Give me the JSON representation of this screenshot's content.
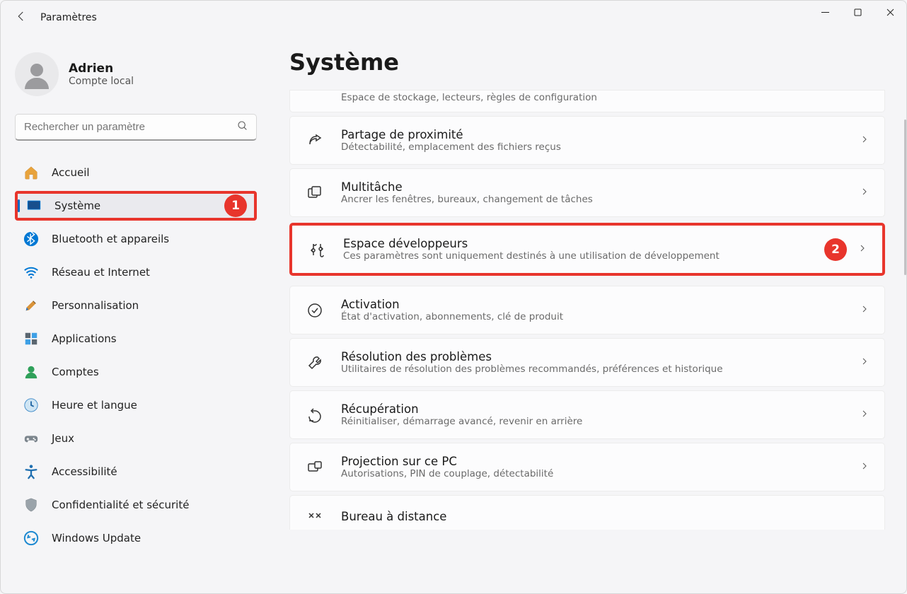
{
  "window": {
    "app_title": "Paramètres"
  },
  "user": {
    "name": "Adrien",
    "subtitle": "Compte local"
  },
  "search": {
    "placeholder": "Rechercher un paramètre"
  },
  "sidebar": {
    "items": [
      {
        "label": "Accueil"
      },
      {
        "label": "Système"
      },
      {
        "label": "Bluetooth et appareils"
      },
      {
        "label": "Réseau et Internet"
      },
      {
        "label": "Personnalisation"
      },
      {
        "label": "Applications"
      },
      {
        "label": "Comptes"
      },
      {
        "label": "Heure et langue"
      },
      {
        "label": "Jeux"
      },
      {
        "label": "Accessibilité"
      },
      {
        "label": "Confidentialité et sécurité"
      },
      {
        "label": "Windows Update"
      }
    ]
  },
  "page": {
    "title": "Système"
  },
  "annotations": {
    "badge1": "1",
    "badge2": "2"
  },
  "cards": {
    "storage": {
      "sub": "Espace de stockage, lecteurs, règles de configuration"
    },
    "nearby": {
      "title": "Partage de proximité",
      "sub": "Détectabilité, emplacement des fichiers reçus"
    },
    "multitask": {
      "title": "Multitâche",
      "sub": "Ancrer les fenêtres, bureaux, changement de tâches"
    },
    "devspace": {
      "title": "Espace développeurs",
      "sub": "Ces paramètres sont uniquement destinés à une utilisation de développement"
    },
    "activation": {
      "title": "Activation",
      "sub": "État d'activation, abonnements, clé de produit"
    },
    "troubleshoot": {
      "title": "Résolution des problèmes",
      "sub": "Utilitaires de résolution des problèmes recommandés, préférences et historique"
    },
    "recovery": {
      "title": "Récupération",
      "sub": "Réinitialiser, démarrage avancé, revenir en arrière"
    },
    "projection": {
      "title": "Projection sur ce PC",
      "sub": "Autorisations, PIN de couplage, détectabilité"
    },
    "remote": {
      "title": "Bureau à distance"
    }
  }
}
